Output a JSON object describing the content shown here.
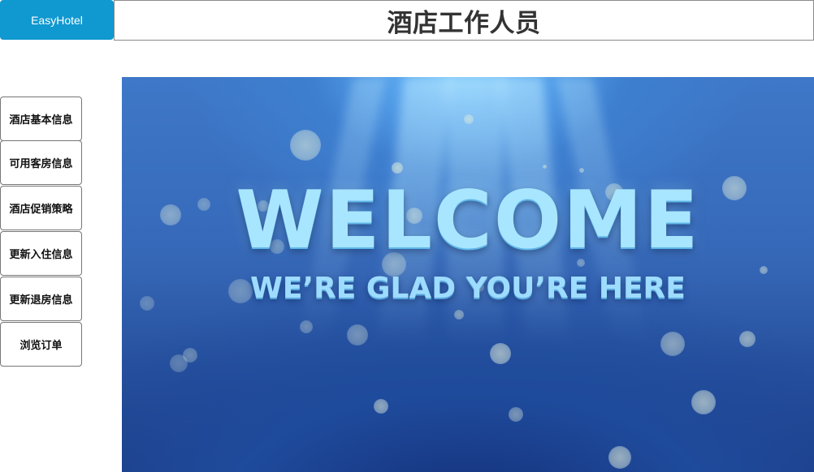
{
  "header": {
    "logo_label": "EasyHotel",
    "title": "酒店工作人员"
  },
  "sidebar": {
    "items": [
      {
        "label": "酒店基本信息"
      },
      {
        "label": "可用客房信息"
      },
      {
        "label": "酒店促销策略"
      },
      {
        "label": "更新入住信息"
      },
      {
        "label": "更新退房信息"
      },
      {
        "label": "浏览订单"
      }
    ]
  },
  "banner": {
    "headline": "WELCOME",
    "subline": "WE’RE GLAD YOU’RE HERE"
  },
  "colors": {
    "logo_bg": "#1098d0",
    "banner_base": "#3668b8",
    "banner_text": "#a8e6ff"
  }
}
